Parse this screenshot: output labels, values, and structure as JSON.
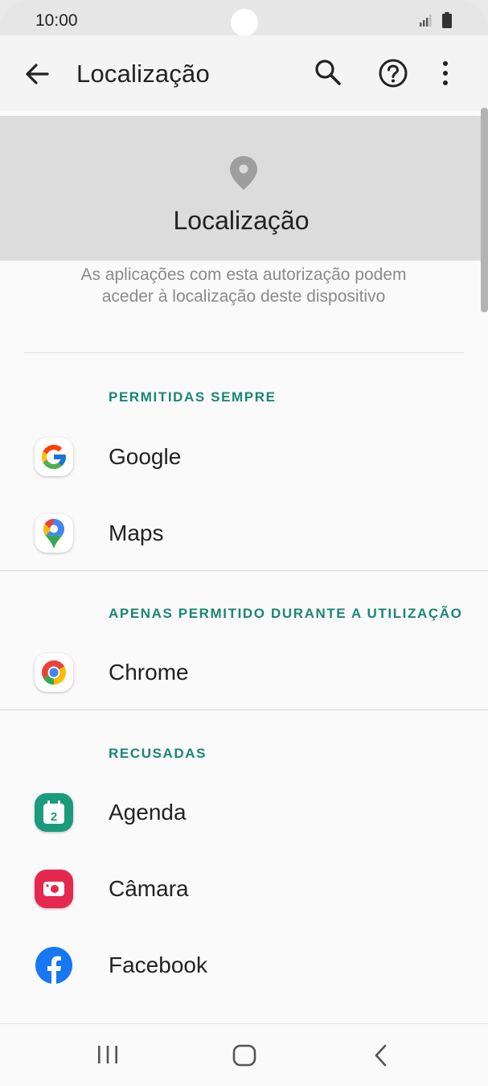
{
  "status_bar": {
    "time": "10:00"
  },
  "app_bar": {
    "title": "Localização",
    "icons": [
      "back-arrow-icon",
      "search-icon",
      "help-icon",
      "more-vert-icon"
    ]
  },
  "header": {
    "title": "Localização",
    "icon": "location-pin-icon",
    "description": "As aplicações com esta autorização podem aceder à localização deste dispositivo"
  },
  "sections": [
    {
      "header": "PERMITIDAS SEMPRE",
      "apps": [
        {
          "label": "Google",
          "icon": "google-icon"
        },
        {
          "label": "Maps",
          "icon": "maps-icon"
        }
      ]
    },
    {
      "header": "APENAS PERMITIDO DURANTE A UTILIZAÇÃO",
      "apps": [
        {
          "label": "Chrome",
          "icon": "chrome-icon"
        }
      ]
    },
    {
      "header": "RECUSADAS",
      "apps": [
        {
          "label": "Agenda",
          "icon": "calendar-icon",
          "icon_text": "2"
        },
        {
          "label": "Câmara",
          "icon": "camera-icon"
        },
        {
          "label": "Facebook",
          "icon": "facebook-icon"
        }
      ]
    }
  ],
  "nav_bar": {
    "icons": [
      "recents-icon",
      "home-icon",
      "back-icon"
    ]
  },
  "colors": {
    "accent": "#1a8577",
    "header_bg": "#dcdcdc",
    "background": "#fafafa"
  }
}
